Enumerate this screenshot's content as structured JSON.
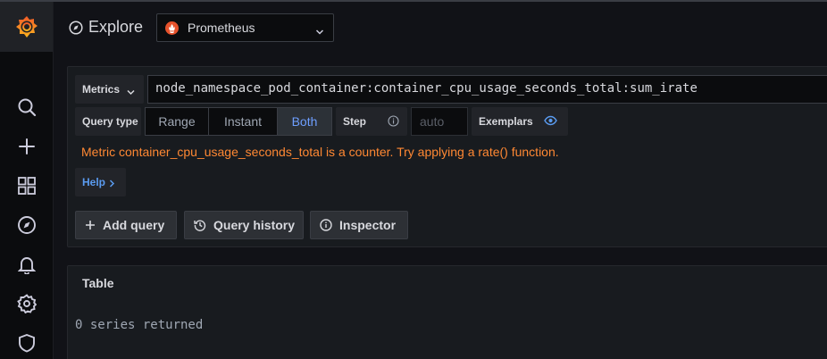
{
  "header": {
    "title": "Explore",
    "datasource": "Prometheus"
  },
  "sidebar": {
    "items": [
      {
        "icon": "search-icon"
      },
      {
        "icon": "plus-icon"
      },
      {
        "icon": "dashboards-icon"
      },
      {
        "icon": "explore-icon"
      },
      {
        "icon": "bell-icon"
      },
      {
        "icon": "gear-icon"
      },
      {
        "icon": "shield-icon"
      }
    ]
  },
  "query": {
    "metrics_label": "Metrics",
    "metric_value": "node_namespace_pod_container:container_cpu_usage_seconds_total:sum_irate",
    "query_type_label": "Query type",
    "query_types": [
      "Range",
      "Instant",
      "Both"
    ],
    "selected_query_type": "Both",
    "step_label": "Step",
    "step_placeholder": "auto",
    "exemplars_label": "Exemplars",
    "warning": "Metric container_cpu_usage_seconds_total is a counter. Try applying a rate() function.",
    "help_label": "Help"
  },
  "actions": {
    "add_query": "Add query",
    "query_history": "Query history",
    "inspector": "Inspector"
  },
  "table": {
    "title": "Table",
    "empty_text": "0 series returned"
  },
  "colors": {
    "background": "#111217",
    "panel": "#181b1f",
    "accent_blue": "#6e9fff",
    "warning_orange": "#ff8833",
    "prometheus": "#e6522c",
    "grafana_logo": "#f05a28"
  }
}
